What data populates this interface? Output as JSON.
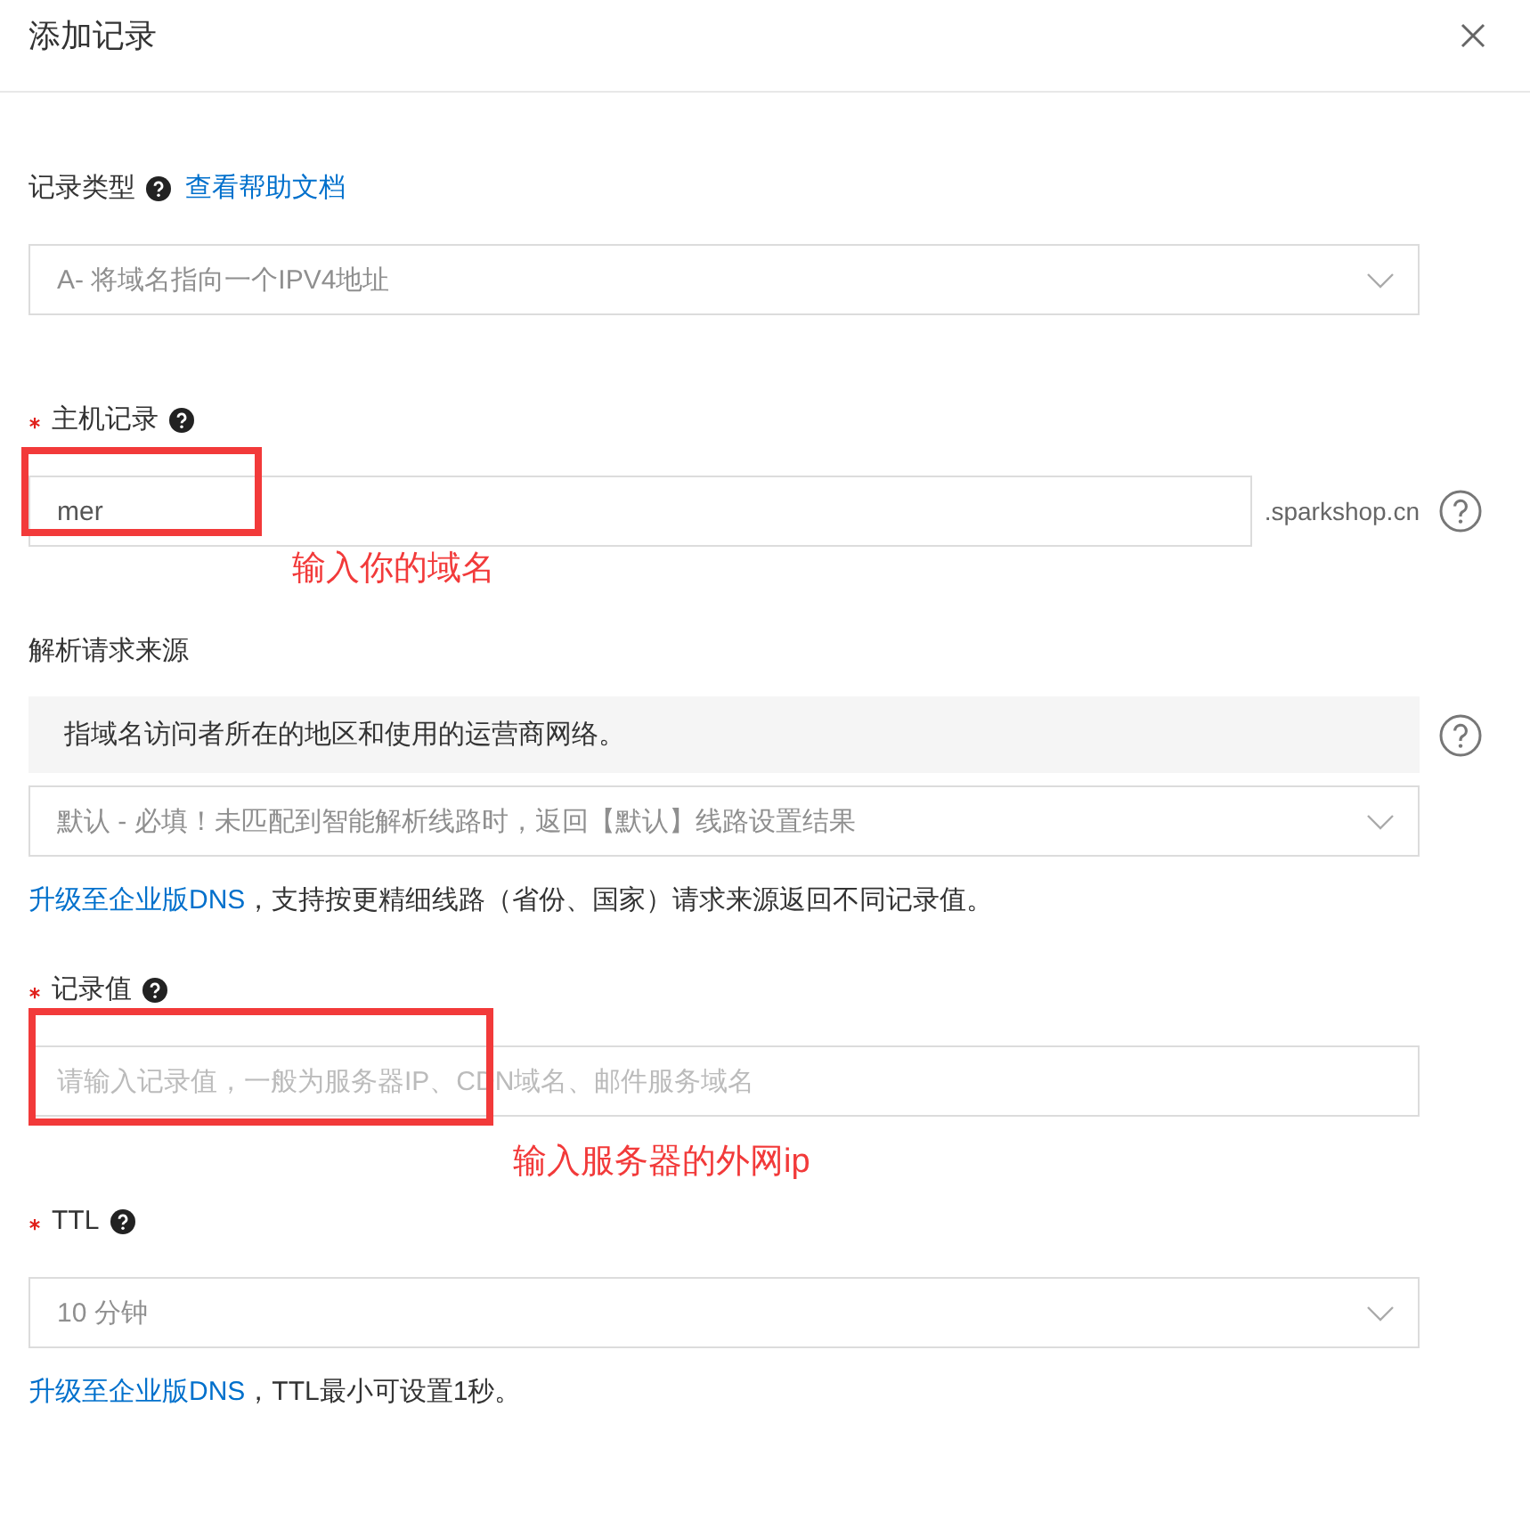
{
  "dialog": {
    "title": "添加记录"
  },
  "form": {
    "fields": [
      {
        "kind": "select",
        "label": "记录类型",
        "required": false,
        "help_icon": true,
        "help_link": "查看帮助文档",
        "side_help_icon": false,
        "value": "A- 将域名指向一个IPV4地址"
      },
      {
        "kind": "input",
        "label": "主机记录",
        "required": true,
        "help_icon": true,
        "side_help_icon": true,
        "value": "mer",
        "suffix": ".sparkshop.cn",
        "annotation": "输入你的域名"
      },
      {
        "kind": "select",
        "label": "解析请求来源",
        "required": false,
        "help_icon": false,
        "info": "指域名访问者所在的地区和使用的运营商网络。",
        "side_help_icon": true,
        "value": "默认 - 必填！未匹配到智能解析线路时，返回【默认】线路设置结果",
        "note": {
          "link": "升级至企业版DNS",
          "text": "，支持按更精细线路（省份、国家）请求来源返回不同记录值。"
        }
      },
      {
        "kind": "input",
        "label": "记录值",
        "required": true,
        "help_icon": true,
        "side_help_icon": false,
        "placeholder": "请输入记录值，一般为服务器IP、CDN域名、邮件服务域名",
        "annotation": "输入服务器的外网ip"
      },
      {
        "kind": "select",
        "label": "TTL",
        "required": true,
        "help_icon": true,
        "side_help_icon": false,
        "value": "10 分钟",
        "note": {
          "link": "升级至企业版DNS",
          "text": "，TTL最小可设置1秒。"
        }
      }
    ]
  }
}
